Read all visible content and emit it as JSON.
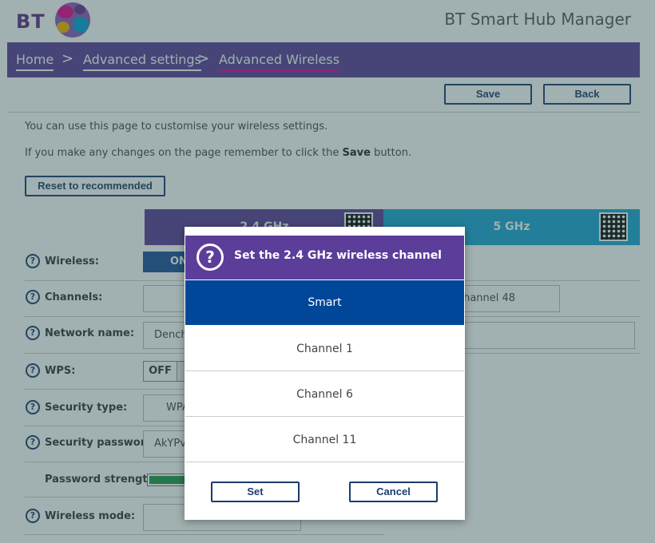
{
  "header": {
    "logo_text": "BT",
    "app_title": "BT Smart Hub Manager"
  },
  "breadcrumb": [
    "Home",
    "Advanced settings",
    "Advanced Wireless"
  ],
  "breadcrumb_separator": ">",
  "actions": {
    "save_label": "Save",
    "back_label": "Back",
    "reset_label": "Reset to recommended"
  },
  "intro": {
    "line1": "You can use this page to customise your wireless settings.",
    "line2_prefix": "If you make any changes on the page remember to click the ",
    "line2_bold": "Save",
    "line2_suffix": " button."
  },
  "bands": {
    "band_24_label": "2.4 GHz",
    "band_5_label": "5 GHz"
  },
  "rows": [
    {
      "label": "Wireless:"
    },
    {
      "label": "Channels:"
    },
    {
      "label": "Network name:"
    },
    {
      "label": "WPS:"
    },
    {
      "label": "Security type:"
    },
    {
      "label": "Security password:"
    },
    {
      "label": "Password strength:"
    },
    {
      "label": "Wireless mode:"
    }
  ],
  "help_glyph": "?",
  "values": {
    "wireless_toggle": "ON",
    "channel_5ghz": "Channel 48",
    "network_name_partial": "Dench",
    "wps_toggle": "OFF",
    "security_type_partial": "WPA",
    "password_partial": "AkYPv",
    "password_strength_fraction": 0.85
  },
  "dialog": {
    "title": "Set the 2.4 GHz wireless channel",
    "options": [
      "Smart",
      "Channel 1",
      "Channel 6",
      "Channel 11"
    ],
    "selected": "Smart",
    "set_label": "Set",
    "cancel_label": "Cancel"
  },
  "colors": {
    "brand_purple": "#5c3d99",
    "selected_blue": "#004799",
    "band_5_blue": "#1aa7d6",
    "accent_pink": "#e5008c",
    "strength_green": "#1e9a4a"
  }
}
